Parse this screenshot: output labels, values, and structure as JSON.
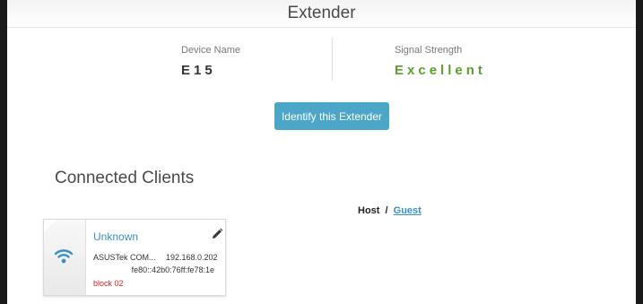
{
  "panel": {
    "title": "Extender"
  },
  "device": {
    "name_label": "Device Name",
    "name_value": "E15",
    "signal_label": "Signal Strength",
    "signal_value": "Excellent",
    "signal_color": "#5aa02c"
  },
  "identify_button": {
    "label": "Identify this Extender"
  },
  "clients_section": {
    "title": "Connected Clients",
    "filter_host": "Host",
    "filter_separator": "/",
    "filter_guest": "Guest"
  },
  "clients": [
    {
      "name": "Unknown",
      "vendor": "ASUSTek COM...",
      "ipv4": "192.168.0.202",
      "ipv6": "fe80::42b0:76ff:fe78:1e",
      "status": "block 02",
      "icon": "wifi-icon",
      "edit_icon": "pencil-icon"
    }
  ],
  "colors": {
    "accent": "#4ba6c8",
    "link": "#3a8fc4",
    "status_block": "#e02020"
  }
}
